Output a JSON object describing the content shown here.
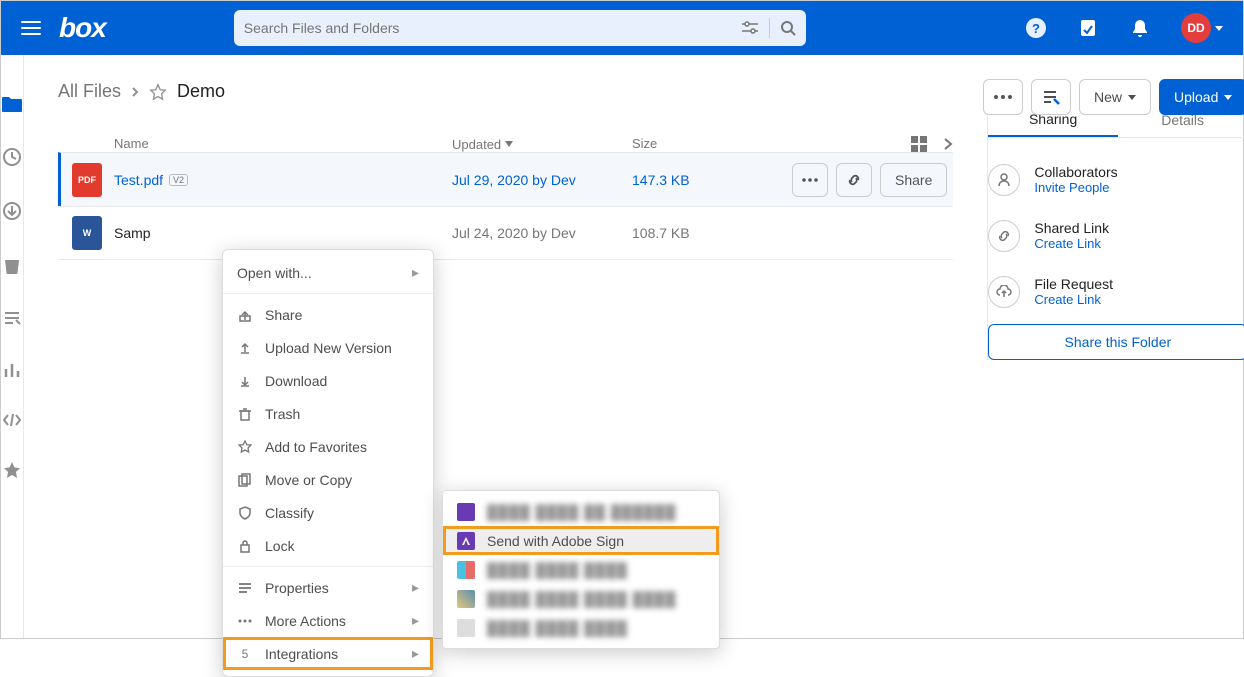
{
  "header": {
    "logo": "box",
    "search_placeholder": "Search Files and Folders",
    "avatar_initials": "DD"
  },
  "breadcrumb": {
    "root": "All Files",
    "current": "Demo"
  },
  "toolbar": {
    "new_label": "New",
    "upload_label": "Upload"
  },
  "columns": {
    "name": "Name",
    "updated": "Updated",
    "size": "Size"
  },
  "files": [
    {
      "name": "Test.pdf",
      "badge": "V2",
      "updated": "Jul 29, 2020 by Dev",
      "size": "147.3 KB",
      "type": "pdf",
      "icon_label": "PDF"
    },
    {
      "name": "Samp",
      "updated": "Jul 24, 2020 by Dev",
      "size": "108.7 KB",
      "type": "docx",
      "icon_label": "W"
    }
  ],
  "row_actions": {
    "share": "Share"
  },
  "context_menu": {
    "open_with": "Open with...",
    "share": "Share",
    "upload_new_version": "Upload New Version",
    "download": "Download",
    "trash": "Trash",
    "add_favorites": "Add to Favorites",
    "move_copy": "Move or Copy",
    "classify": "Classify",
    "lock": "Lock",
    "properties": "Properties",
    "more_actions": "More Actions",
    "integrations": "Integrations",
    "integrations_count": "5"
  },
  "submenu": {
    "adobe": "Send with Adobe Sign"
  },
  "sidebar_tabs": {
    "sharing": "Sharing",
    "details": "Details"
  },
  "panel": {
    "collaborators": {
      "title": "Collaborators",
      "link": "Invite People"
    },
    "shared_link": {
      "title": "Shared Link",
      "link": "Create Link"
    },
    "file_request": {
      "title": "File Request",
      "link": "Create Link"
    },
    "share_folder": "Share this Folder"
  }
}
